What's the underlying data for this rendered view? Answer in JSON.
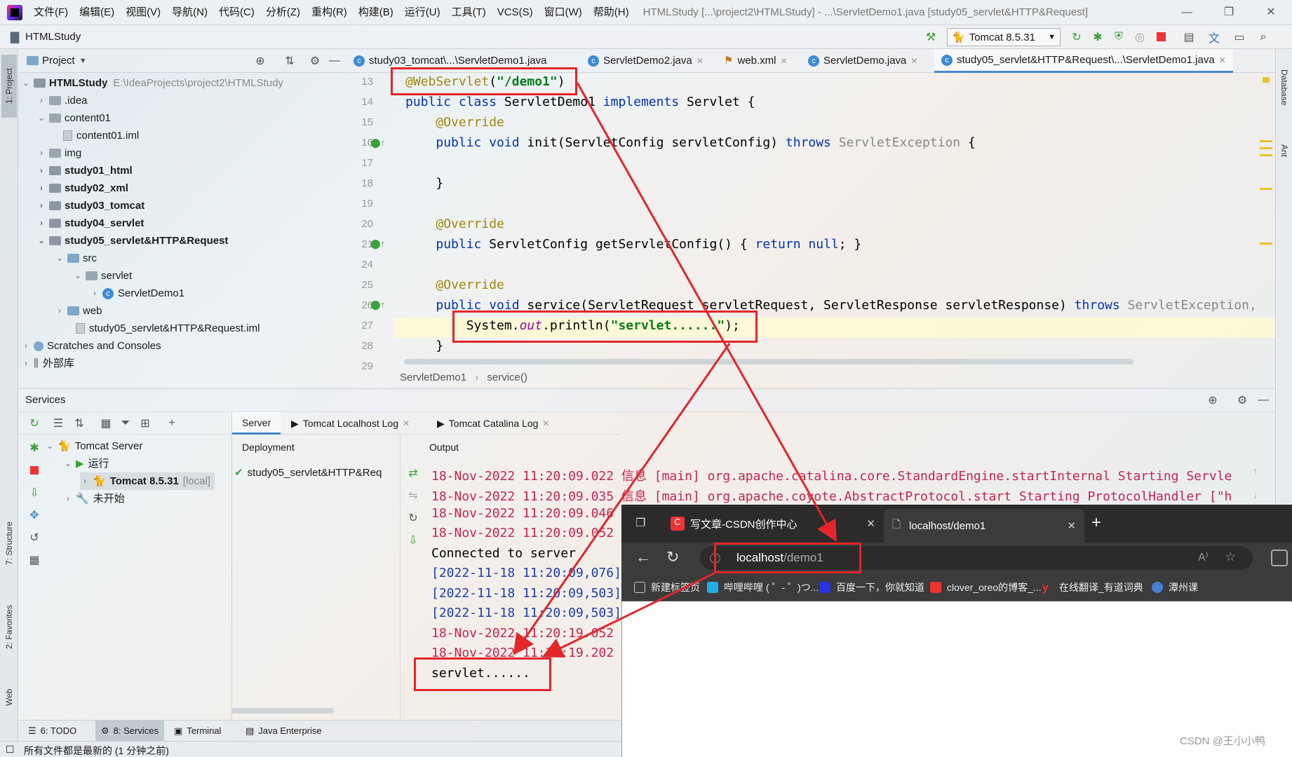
{
  "menu": {
    "items": [
      "文件(F)",
      "编辑(E)",
      "视图(V)",
      "导航(N)",
      "代码(C)",
      "分析(Z)",
      "重构(R)",
      "构建(B)",
      "运行(U)",
      "工具(T)",
      "VCS(S)",
      "窗口(W)",
      "帮助(H)"
    ],
    "window_title": "HTMLStudy [...\\project2\\HTMLStudy] - ...\\ServletDemo1.java [study05_servlet&HTTP&Request]"
  },
  "toolbar": {
    "project_name": "HTMLStudy",
    "run_config": "Tomcat 8.5.31"
  },
  "left_strip": {
    "project": "1: Project",
    "structure": "7: Structure",
    "favorites": "2: Favorites",
    "web": "Web"
  },
  "right_strip": {
    "database": "Database",
    "ant": "Ant"
  },
  "project_panel": {
    "title": "Project",
    "root_name": "HTMLStudy",
    "root_path": "E:\\IdeaProjects\\project2\\HTMLStudy",
    "tree": [
      ".idea",
      "content01",
      "content01.iml",
      "img",
      "study01_html",
      "study02_xml",
      "study03_tomcat",
      "study04_servlet",
      "study05_servlet&HTTP&Request",
      "src",
      "servlet",
      "ServletDemo1",
      "web",
      "study05_servlet&HTTP&Request.iml",
      "Scratches and Consoles",
      "外部库"
    ]
  },
  "editor": {
    "tabs": [
      "study03_tomcat\\...\\ServletDemo1.java",
      "ServletDemo2.java",
      "web.xml",
      "ServletDemo.java",
      "study05_servlet&HTTP&Request\\...\\ServletDemo1.java"
    ],
    "line_numbers": [
      "13",
      "14",
      "15",
      "16",
      "17",
      "18",
      "19",
      "20",
      "21",
      "24",
      "25",
      "26",
      "27",
      "28",
      "29"
    ],
    "breadcrumb": [
      "ServletDemo1",
      "service()"
    ]
  },
  "services": {
    "title": "Services",
    "tree": [
      "Tomcat Server",
      "运行",
      "Tomcat 8.5.31",
      "[local]",
      "未开始"
    ],
    "tabs": [
      "Server",
      "Tomcat Localhost Log",
      "Tomcat Catalina Log"
    ],
    "deployment_header": "Deployment",
    "output_header": "Output",
    "deployment_item": "study05_servlet&HTTP&Req",
    "log": [
      "18-Nov-2022 11:20:09.022 信息 [main] org.apache.catalina.core.StandardEngine.startInternal Starting Servle",
      "18-Nov-2022 11:20:09.035 信息 [main] org.apache.coyote.AbstractProtocol.start Starting ProtocolHandler [\"h",
      "18-Nov-2022 11:20:09.046",
      "18-Nov-2022 11:20:09.052",
      "Connected to server",
      "[2022-11-18 11:20:09,076]",
      "[2022-11-18 11:20:09,503]",
      "[2022-11-18 11:20:09,503]",
      "18-Nov-2022 11:20:19.052",
      "18-Nov-2022 11:20:19.202",
      "servlet......"
    ]
  },
  "browser": {
    "tab1": "写文章-CSDN创作中心",
    "tab2": "localhost/demo1",
    "url_host": "localhost",
    "url_path": "/demo1",
    "bookmarks": [
      "新建标签页",
      "哔哩哔哩 ( ゜- ゜)つ...",
      "百度一下，你就知道",
      "clover_oreo的博客_...",
      "在线翻译_有道词典",
      "潭州课"
    ]
  },
  "bottom_tabs": [
    "6: TODO",
    "8: Services",
    "Terminal",
    "Java Enterprise"
  ],
  "status_text": "所有文件都是最新的 (1 分钟之前)",
  "watermark": "CSDN @王小小鸭",
  "colors": {
    "annotation_red": "#e3262a",
    "keyword": "#0033b3",
    "string": "#067d17",
    "log_red": "#c7254e",
    "log_blue": "#1c3faa"
  }
}
